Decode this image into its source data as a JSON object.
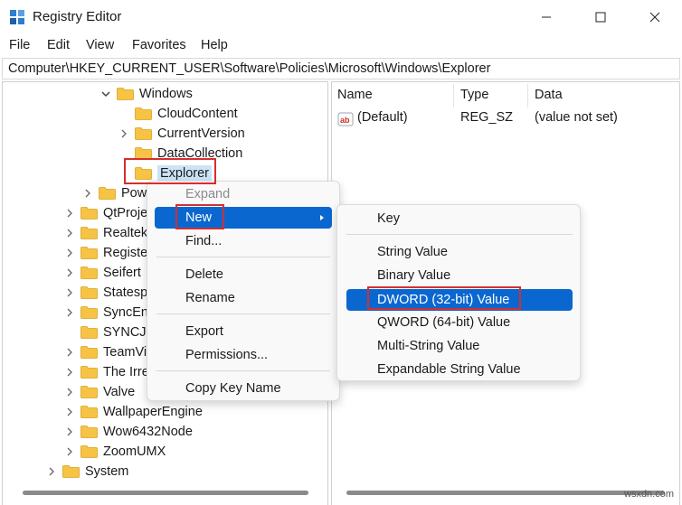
{
  "window": {
    "title": "Registry Editor",
    "icon": "registry-editor-icon",
    "controls": [
      "minimize-icon",
      "maximize-icon",
      "close-icon"
    ]
  },
  "menu": [
    "File",
    "Edit",
    "View",
    "Favorites",
    "Help"
  ],
  "address": "Computer\\HKEY_CURRENT_USER\\Software\\Policies\\Microsoft\\Windows\\Explorer",
  "tree": [
    {
      "label": "Windows",
      "expander": "expanded"
    },
    {
      "label": "CloudContent",
      "expander": "none"
    },
    {
      "label": "CurrentVersion",
      "expander": "collapsed"
    },
    {
      "label": "DataCollection",
      "expander": "none"
    },
    {
      "label": "Explorer",
      "expander": "none",
      "selected": true
    },
    {
      "label": "Pow",
      "expander": "collapsed"
    },
    {
      "label": "QtProje",
      "expander": "collapsed"
    },
    {
      "label": "Realtek",
      "expander": "collapsed"
    },
    {
      "label": "Registe",
      "expander": "collapsed"
    },
    {
      "label": "Seifert",
      "expander": "collapsed"
    },
    {
      "label": "Statesp",
      "expander": "collapsed"
    },
    {
      "label": "SyncEng",
      "expander": "collapsed"
    },
    {
      "label": "SYNCJM",
      "expander": "none"
    },
    {
      "label": "TeamVi",
      "expander": "collapsed"
    },
    {
      "label": "The Irre",
      "expander": "collapsed"
    },
    {
      "label": "Valve",
      "expander": "collapsed"
    },
    {
      "label": "WallpaperEngine",
      "expander": "collapsed"
    },
    {
      "label": "Wow6432Node",
      "expander": "collapsed"
    },
    {
      "label": "ZoomUMX",
      "expander": "collapsed"
    },
    {
      "label": "System",
      "expander": "collapsed"
    }
  ],
  "values_pane": {
    "headers": {
      "name": "Name",
      "type": "Type",
      "data": "Data"
    },
    "rows": [
      {
        "name": "(Default)",
        "type": "REG_SZ",
        "data": "(value not set)",
        "icon": "string-value-icon"
      }
    ]
  },
  "context_menu": {
    "items": [
      "Expand",
      "New",
      "Find...",
      "Delete",
      "Rename",
      "Export",
      "Permissions...",
      "Copy Key Name"
    ],
    "highlighted": "New",
    "disabled": "Expand"
  },
  "new_submenu": {
    "items": [
      "Key",
      "String Value",
      "Binary Value",
      "DWORD (32-bit) Value",
      "QWORD (64-bit) Value",
      "Multi-String Value",
      "Expandable String Value"
    ],
    "highlighted": "DWORD (32-bit) Value"
  },
  "colors": {
    "highlight": "#0a67d0",
    "annotation_box": "#d32f2f",
    "folder": "#f6c344"
  },
  "watermark": "wsxdn.com"
}
